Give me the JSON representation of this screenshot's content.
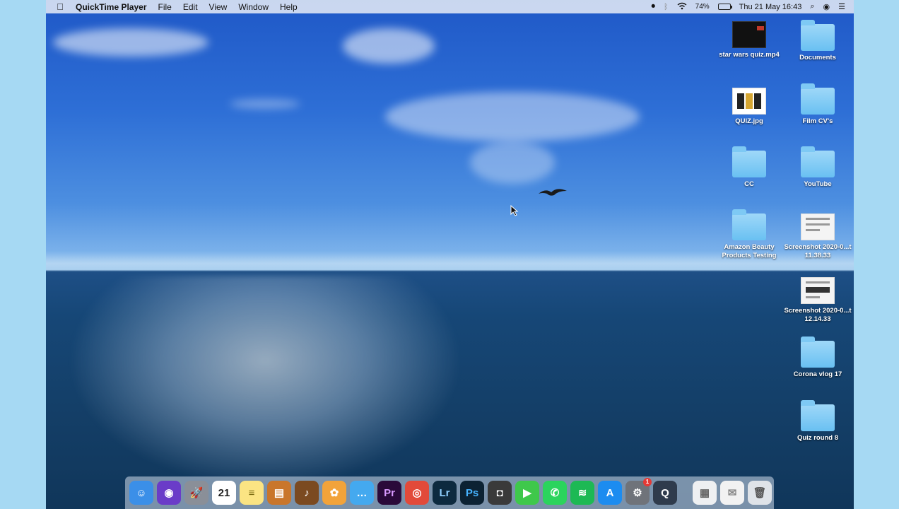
{
  "menubar": {
    "apple_icon": "apple-logo-icon",
    "app_name": "QuickTime Player",
    "menus": [
      "File",
      "Edit",
      "View",
      "Window",
      "Help"
    ],
    "battery_percent": "74%",
    "datetime": "Thu 21 May  16:43",
    "status_icons": [
      "record-icon",
      "bluetooth-icon",
      "wifi-icon",
      "battery-icon",
      "spotlight-icon",
      "siri-icon",
      "notification-center-icon"
    ]
  },
  "desktop": {
    "items": [
      {
        "label": "star wars quiz.mp4",
        "type": "video"
      },
      {
        "label": "Documents",
        "type": "folder"
      },
      {
        "label": "QUIZ.jpg",
        "type": "jpg"
      },
      {
        "label": "Film CV's",
        "type": "folder"
      },
      {
        "label": "CC",
        "type": "folder"
      },
      {
        "label": "YouTube",
        "type": "folder"
      },
      {
        "label": "Amazon Beauty Products Testing",
        "type": "folder"
      },
      {
        "label": "Screenshot 2020-0...t 11.38.33",
        "type": "screenshot"
      },
      {
        "label": "Screenshot 2020-0...t 12.14.33",
        "type": "screenshot"
      },
      {
        "label": "Corona vlog 17",
        "type": "folder"
      },
      {
        "label": "Quiz round 8",
        "type": "folder"
      }
    ]
  },
  "dock": {
    "apps": [
      {
        "name": "finder-icon",
        "glyph": "☺",
        "color": "#3b8fe8"
      },
      {
        "name": "siri-icon",
        "glyph": "◉",
        "color": "#6a3cc8"
      },
      {
        "name": "launchpad-icon",
        "glyph": "🚀",
        "color": "#8a8f98"
      },
      {
        "name": "calendar-icon",
        "glyph": "21",
        "color": "#ffffff",
        "text": "#222"
      },
      {
        "name": "notes-icon",
        "glyph": "≡",
        "color": "#fbe483",
        "text": "#7a6a10"
      },
      {
        "name": "books-icon",
        "glyph": "▤",
        "color": "#c9762b"
      },
      {
        "name": "garageband-icon",
        "glyph": "♪",
        "color": "#7b4a21"
      },
      {
        "name": "photos-icon",
        "glyph": "✿",
        "color": "#f2a33a"
      },
      {
        "name": "messages-icon",
        "glyph": "…",
        "color": "#44a9ef"
      },
      {
        "name": "premiere-pro-icon",
        "glyph": "Pr",
        "color": "#2a0a3a",
        "text": "#d99bff"
      },
      {
        "name": "chrome-icon",
        "glyph": "◎",
        "color": "#e24a3a"
      },
      {
        "name": "lightroom-icon",
        "glyph": "Lr",
        "color": "#0d2a3f",
        "text": "#8fd0ff"
      },
      {
        "name": "photoshop-icon",
        "glyph": "Ps",
        "color": "#0c2233",
        "text": "#46b3ff"
      },
      {
        "name": "camera-icon",
        "glyph": "◘",
        "color": "#3a3a3a"
      },
      {
        "name": "facetime-icon",
        "glyph": "▶",
        "color": "#3fc84b"
      },
      {
        "name": "whatsapp-icon",
        "glyph": "✆",
        "color": "#2bd45d"
      },
      {
        "name": "spotify-icon",
        "glyph": "≋",
        "color": "#1db954"
      },
      {
        "name": "app-store-icon",
        "glyph": "A",
        "color": "#1c8cf0"
      },
      {
        "name": "system-preferences-icon",
        "glyph": "⚙",
        "color": "#6f737a",
        "badge": "1"
      },
      {
        "name": "quicktime-icon",
        "glyph": "Q",
        "color": "#2f3b4c"
      }
    ],
    "docs": [
      {
        "name": "document-stack-icon",
        "glyph": "▦",
        "color": "#eef0f2",
        "text": "#666"
      },
      {
        "name": "downloads-stack-icon",
        "glyph": "✉",
        "color": "#f2f2f2",
        "text": "#888"
      },
      {
        "name": "trash-icon",
        "glyph": "🗑",
        "color": "#dfe3e8",
        "text": "#555"
      }
    ]
  }
}
